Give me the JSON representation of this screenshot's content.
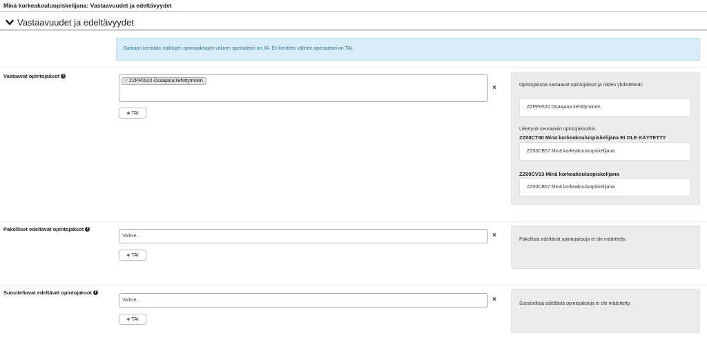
{
  "page": {
    "title": "Minä korkeakouluopiskelijana: Vastaavuudet ja edeltävyydet"
  },
  "section": {
    "title": "Vastaavuudet ja edeltävyydet",
    "icon": "chevron-down-icon"
  },
  "info": {
    "text": "Samaan kenttään valittujen opintojaksojen välinen operaattori on JA. Eri kenttien välinen operaattori on TAI."
  },
  "rows": {
    "vastaavat": {
      "label": "Vastaavat opintojaksot",
      "chip": {
        "remove": "×",
        "label": "ZZPP0520 Osaajana kehittyminen"
      },
      "clear": "×",
      "add_label": "TAI",
      "add_icon": "+",
      "panel": {
        "intro": "Opintojaksoa vastaavat opintojaksot ja niiden yhdistelmät:",
        "card1": "ZZPP0520 Osaajana kehittyminen",
        "linked_intro": "Liitettynä seuraaviin opintojaksoihin.",
        "group1_title": "ZZ00CT80 Minä korkeakouluopiskelijana EI OLE KÄYTETTY",
        "group1_card": "ZZ00CB57 Minä korkeakouluopiskelijana",
        "group2_title": "ZZ00CV13 Minä korkeakouluopiskelijana",
        "group2_card": "ZZ00CB57 Minä korkeakouluopiskelijana"
      }
    },
    "pakolliset": {
      "label": "Pakolliset edeltävät opintojaksot",
      "placeholder": "Valitse...",
      "clear": "×",
      "add_label": "TAI",
      "add_icon": "+",
      "panel_text": "Pakollisia edeltäviä opintojaksoja ei ole määritetty."
    },
    "suositeltavat": {
      "label": "Suositeltavat edeltävät opintojaksot",
      "placeholder": "Valitse...",
      "clear": "×",
      "add_label": "TAI",
      "add_icon": "+",
      "panel_text": "Suositeltuja edeltäviä opintojaksoja ei ole määritetty."
    }
  }
}
